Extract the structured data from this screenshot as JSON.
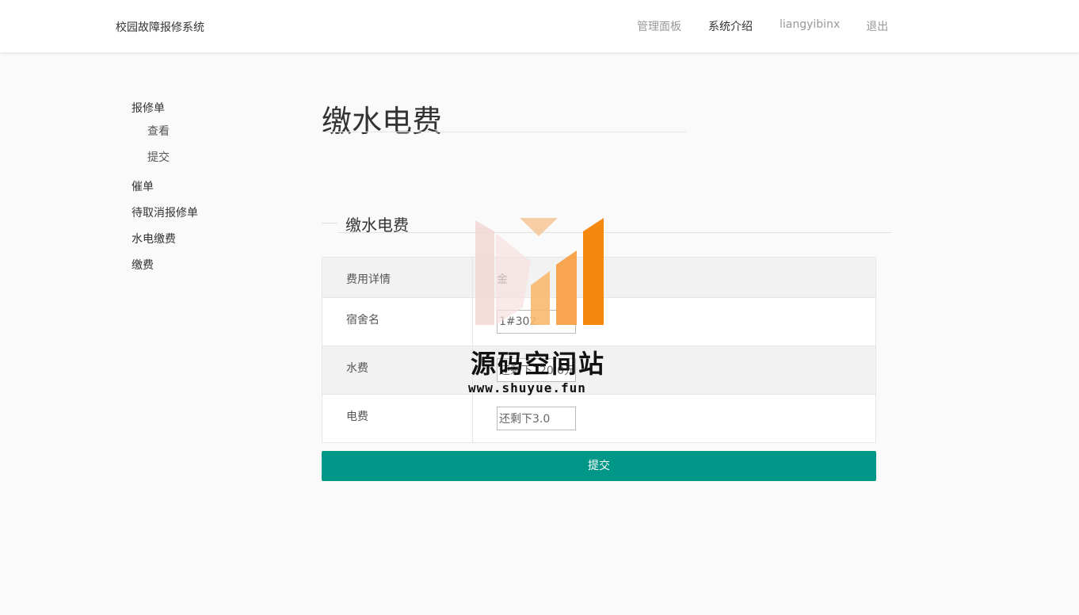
{
  "header": {
    "brand": "校园故障报修系统",
    "nav": [
      {
        "label": "管理面板"
      },
      {
        "label": "系统介绍"
      },
      {
        "label": "liangyibinx"
      },
      {
        "label": "退出"
      }
    ]
  },
  "sidebar": {
    "groups": [
      {
        "label": "报修单",
        "children": [
          {
            "label": "查看"
          },
          {
            "label": "提交"
          }
        ]
      },
      {
        "label": "催单"
      },
      {
        "label": "待取消报修单"
      },
      {
        "label": "水电缴费"
      },
      {
        "label": "缴费"
      }
    ]
  },
  "main": {
    "title": "缴水电费",
    "legend": "缴水电费",
    "table": {
      "header": {
        "label": "费用详情",
        "value": "金"
      },
      "rows": [
        {
          "label": "宿舍名",
          "value": "1#302"
        },
        {
          "label": "水费",
          "value": "还剩下120.0元"
        },
        {
          "label": "电费",
          "value": "还剩下3.0"
        }
      ]
    },
    "submit_label": "提交"
  },
  "watermark": {
    "title": "源码空间站",
    "url": "www.shuyue.fun"
  },
  "colors": {
    "accent": "#009688",
    "watermark_orange": "#f5890f"
  }
}
